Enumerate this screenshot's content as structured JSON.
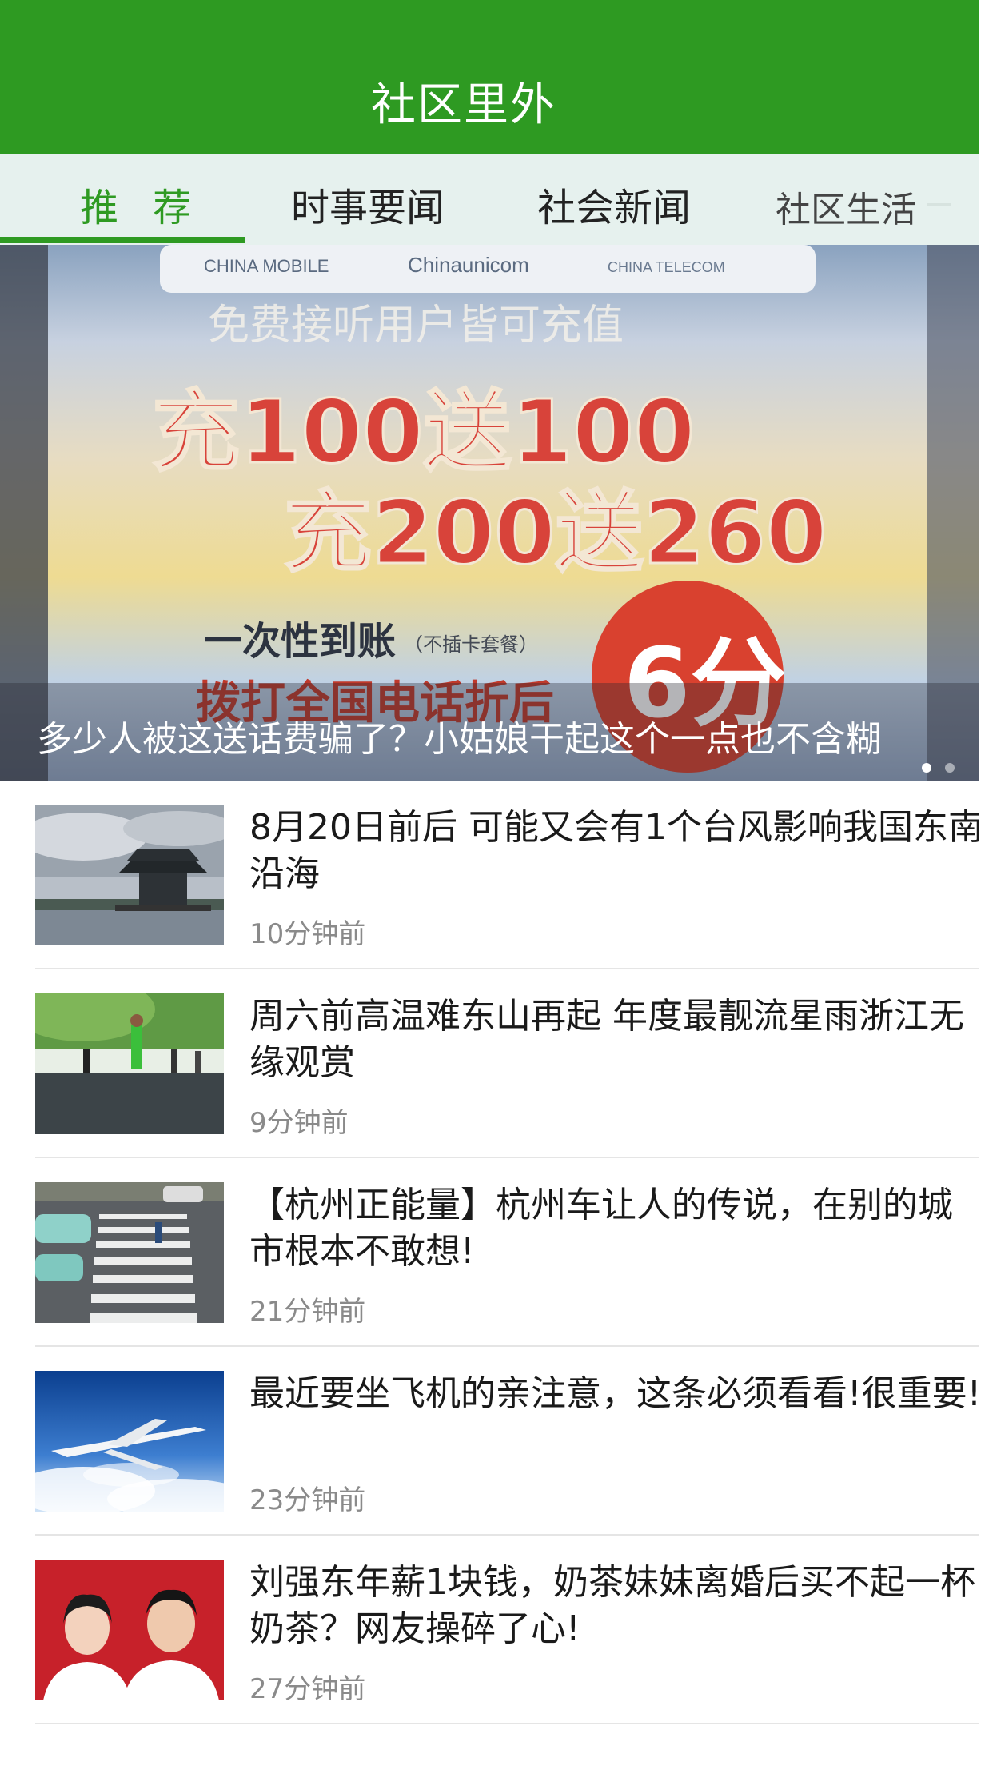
{
  "header": {
    "title": "社区里外"
  },
  "tabs": [
    {
      "label": "推 荐",
      "active": true
    },
    {
      "label": "时事要闻"
    },
    {
      "label": "社会新闻"
    },
    {
      "label": "社区生活"
    }
  ],
  "banner": {
    "caption": "多少人被这送话费骗了？小姑娘干起这个一点也不含糊",
    "image_text": {
      "carriers": [
        "CHINA MOBILE",
        "Chinaunicom",
        "CHINA TELECOM"
      ],
      "line1": "免费接听用户皆可充值",
      "line2": "充100送100",
      "line3": "充200送260",
      "line4": "一次性到账",
      "line4_note": "（不插卡套餐）",
      "line5": "拨打全国电话折后",
      "badge": "6分"
    },
    "dots": 2,
    "active_dot": 0
  },
  "news": [
    {
      "title": "8月20日前后 可能又会有1个台风影响我国东南沿海",
      "time": "10分钟前",
      "thumb": "pavilion-lake-photo"
    },
    {
      "title": "周六前高温难东山再起 年度最靓流星雨浙江无缘观赏",
      "time": "9分钟前",
      "thumb": "lakeside-runner-photo"
    },
    {
      "title": "【杭州正能量】杭州车让人的传说，在别的城市根本不敢想!",
      "time": "21分钟前",
      "thumb": "crosswalk-photo"
    },
    {
      "title": "最近要坐飞机的亲注意，这条必须看看!很重要!",
      "time": "23分钟前",
      "thumb": "airplane-photo"
    },
    {
      "title": "刘强东年薪1块钱，奶茶妹妹离婚后买不起一杯奶茶？网友操碎了心!",
      "time": "27分钟前",
      "thumb": "couple-portrait-photo"
    }
  ],
  "colors": {
    "brand_green": "#2e9a22",
    "tab_bg": "#e6f1ee",
    "time_gray": "#8a8a8a"
  }
}
